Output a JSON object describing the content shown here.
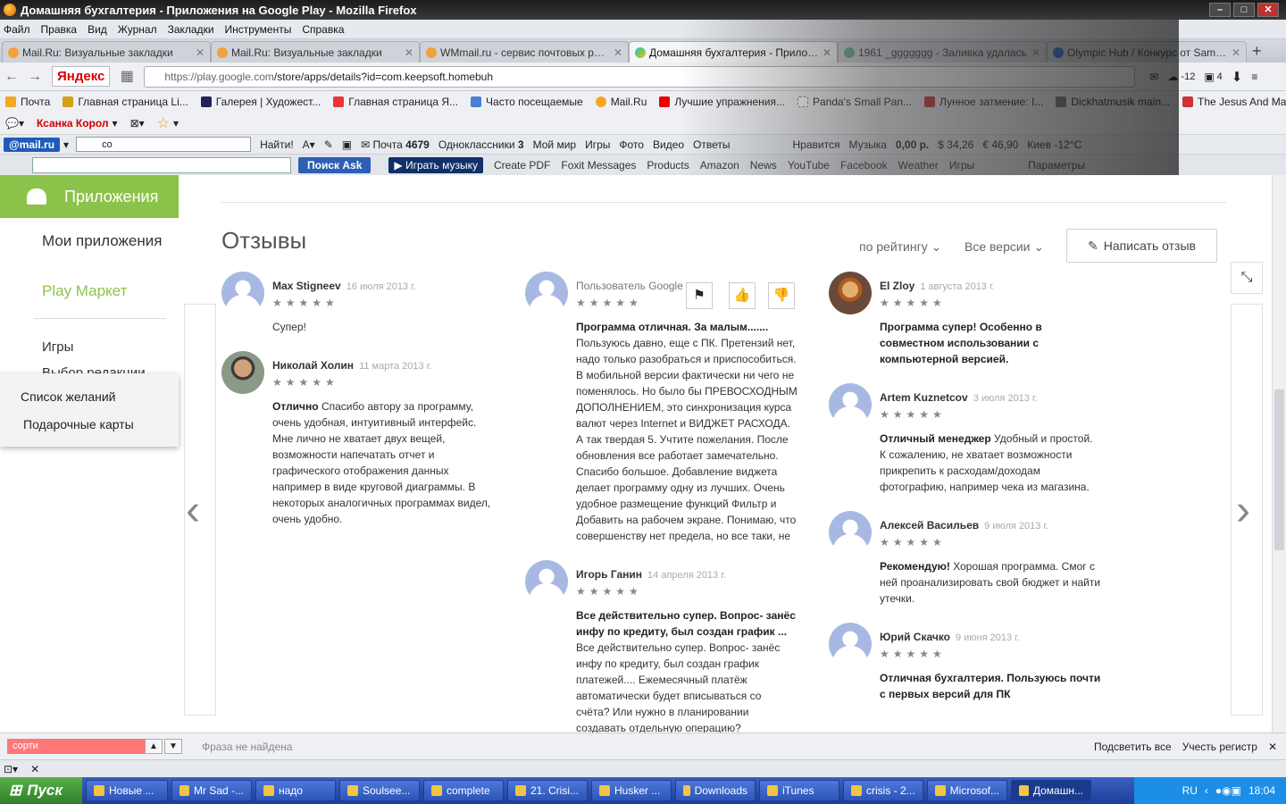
{
  "window": {
    "title": "Домашняя бухгалтерия - Приложения на Google Play - Mozilla Firefox"
  },
  "menu": [
    "Файл",
    "Правка",
    "Вид",
    "Журнал",
    "Закладки",
    "Инструменты",
    "Справка"
  ],
  "tabs": [
    {
      "label": "Mail.Ru: Визуальные закладки",
      "active": false
    },
    {
      "label": "Mail.Ru: Визуальные закладки",
      "active": false
    },
    {
      "label": "WMmail.ru - сервис почтовых рассы...",
      "active": false
    },
    {
      "label": "Домашняя бухгалтерия - Приложен...",
      "active": true
    },
    {
      "label": "1961 _ggggggg - Заливка удалась",
      "active": false
    },
    {
      "label": "Olympic Hub / Конкурс от Samsung M...",
      "active": false
    }
  ],
  "nav": {
    "yandex": "Яндекс",
    "url_host": "https://play.google.com",
    "url_path": "/store/apps/details?id=com.keepsoft.homebuh",
    "weather": "-12",
    "count": "4"
  },
  "bookmarks": [
    "Почта",
    "Главная страница Li...",
    "Галерея | Художест...",
    "Главная страница Я...",
    "Часто посещаемые",
    "Mail.Ru",
    "Лучшие упражнения...",
    "Panda's Small Pan...",
    "Лунное затмение: I...",
    "Dickhatmusik main...",
    "The Jesus And Mary ..."
  ],
  "bar3": {
    "user": "Ксанка Корол"
  },
  "mailbar": {
    "logo": "@mail.ru",
    "search_value": "co",
    "find": "Найти!",
    "mail": "Почта",
    "mail_count": "4679",
    "ok": "Одноклассники",
    "ok_count": "3",
    "items": [
      "Мой мир",
      "Игры",
      "Фото",
      "Видео",
      "Ответы",
      "Нравится",
      "Музыка"
    ],
    "money": "0,00 р.",
    "usd": "34,26",
    "eur": "46,90",
    "city_weather": "Киев -12°C"
  },
  "askbar": {
    "search": "Поиск",
    "play": "Играть музыку",
    "items": [
      "Create PDF",
      "Foxit Messages",
      "Products",
      "Amazon",
      "News",
      "YouTube",
      "Facebook",
      "Weather",
      "Игры"
    ],
    "params": "Параметры"
  },
  "sidebar": {
    "apps": "Приложения",
    "my_apps": "Мои приложения",
    "play_market": "Play Маркет",
    "games": "Игры",
    "editors": "Выбор редакции",
    "wishlist": "Список желаний",
    "giftcards": "Подарочные карты"
  },
  "reviews": {
    "title": "Отзывы",
    "sort": "по рейтингу",
    "versions": "Все версии",
    "write": "Написать отзыв",
    "col1": [
      {
        "name": "Max Stigneev",
        "date": "16 июля 2013 г.",
        "stars": "★★★★★",
        "lead": "",
        "text": "Супер!"
      },
      {
        "name": "Николай Холин",
        "date": "11 марта 2013 г.",
        "stars": "★★★★★",
        "lead": "Отлично",
        "text": " Спасибо автору за программу, очень удобная, интуитивный интерфейс. Мне лично не хватает двух вещей, возможности напечатать отчет и графического отображения данных например в виде круговой диаграммы. В некоторых аналогичных программах видел, очень удобно."
      }
    ],
    "col2": [
      {
        "name": "Пользователь Google",
        "date": "",
        "stars": "★★★★★",
        "lead": "Программа отличная. За малым.......",
        "text": " Пользуюсь давно, еще с ПК. Претензий нет, надо только разобраться и приспособиться. В мобильной версии фактически ни чего не поменялось. Но было бы ПРЕВОСХОДНЫМ ДОПОЛНЕНИЕМ, это синхронизация курса валют через Internet и ВИДЖЕТ РАСХОДА. А так твердая 5. Учтите пожелания. После обновления все работает замечательно. Спасибо большое. Добавление виджета делает программу одну из лучших. Очень удобное размещение функций Фильтр и Добавить на рабочем экране. Понимаю, что совершенству нет предела, но все таки, не м"
      },
      {
        "name": "Игорь Ганин",
        "date": "14 апреля 2013 г.",
        "stars": "★★★★★",
        "lead": "Все действительно супер. Вопрос- занёс инфу по кредиту, был создан график ...",
        "text": " Все действительно супер. Вопрос- занёс инфу по кредиту, был создан график платежей.... Ежемесячный платёж автоматически будет вписываться со счёта? Или нужно в планировании создавать отдельную операцию?"
      }
    ],
    "col3": [
      {
        "name": "El Zloy",
        "date": "1 августа 2013 г.",
        "stars": "★★★★★",
        "lead": "Программа супер! Особенно в совместном использовании с компьютерной версией.",
        "text": ""
      },
      {
        "name": "Artem Kuznetcov",
        "date": "3 июля 2013 г.",
        "stars": "★★★★★",
        "lead": "Отличный менеджер",
        "text": " Удобный и простой. К сожалению, не хватает возможности прикрепить к расходам/доходам фотографию, например чека из магазина."
      },
      {
        "name": "Алексей Васильев",
        "date": "9 июля 2013 г.",
        "stars": "★★★★★",
        "lead": "Рекомендую!",
        "text": " Хорошая программа. Смог с ней проанализировать свой бюджет и найти утечки."
      },
      {
        "name": "Юрий Скачко",
        "date": "9 июня 2013 г.",
        "stars": "★★★★★",
        "lead": "Отличная бухгалтерия. Пользуюсь почти с первых версий для ПК",
        "text": ""
      }
    ]
  },
  "findbar": {
    "value": "сорти",
    "status": "Фраза не найдена",
    "highlight": "Подсветить все",
    "matchcase": "Учесть регистр"
  },
  "taskbar": {
    "start": "Пуск",
    "items": [
      "Новые ...",
      "Mr Sad -...",
      "надо",
      "Soulsee...",
      "complete",
      "21. Crisi...",
      "Husker ...",
      "Downloads",
      "iTunes",
      "crisis - 2...",
      "Microsof...",
      "Домашн..."
    ],
    "lang": "RU",
    "time": "18:04"
  }
}
